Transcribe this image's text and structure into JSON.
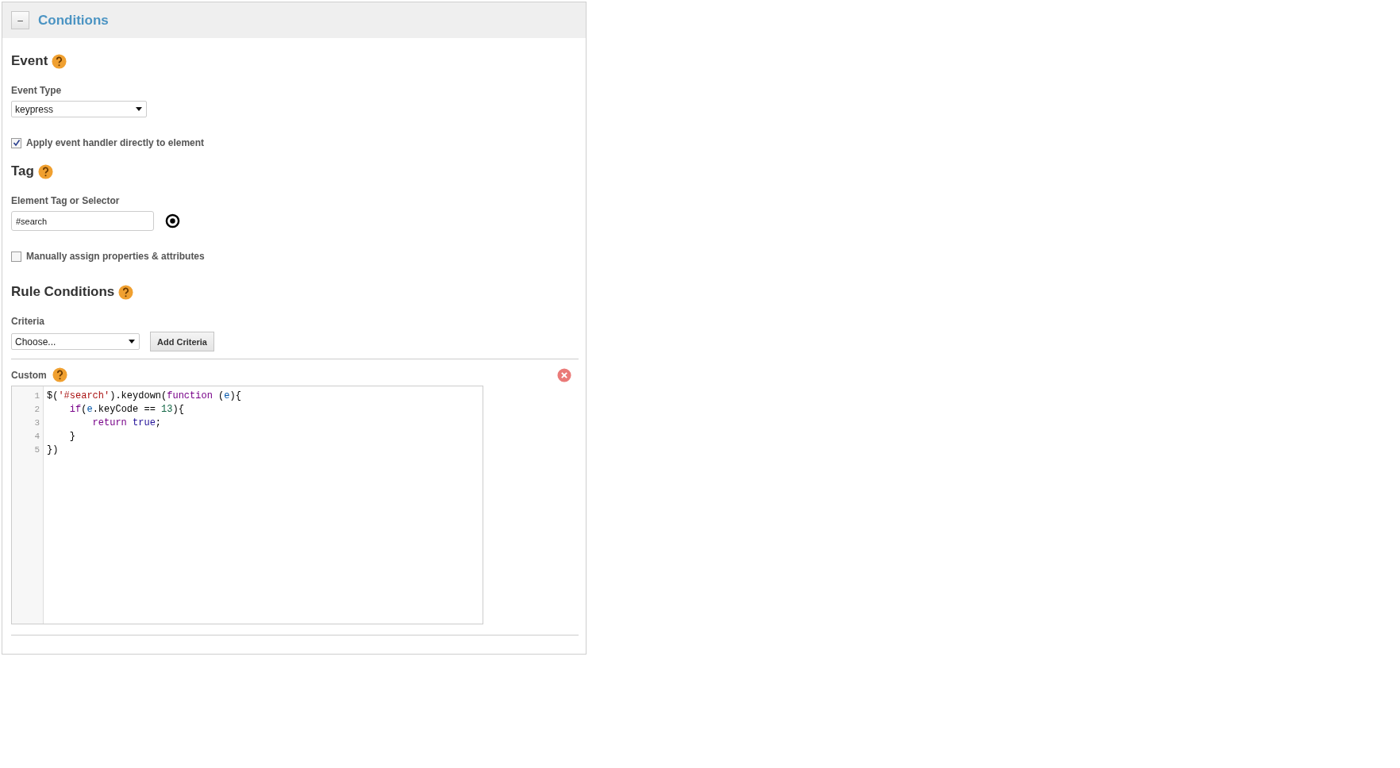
{
  "panel": {
    "title": "Conditions",
    "collapse_button": "–",
    "expanded": true
  },
  "event": {
    "heading": "Event",
    "type_label": "Event Type",
    "type_value": "keypress",
    "apply_label": "Apply event handler directly to element",
    "apply_checked": true
  },
  "tag": {
    "heading": "Tag",
    "selector_label": "Element Tag or Selector",
    "selector_value": "#search",
    "manual_label": "Manually assign properties & attributes",
    "manual_checked": false
  },
  "rule_conditions": {
    "heading": "Rule Conditions",
    "criteria_label": "Criteria",
    "criteria_value": "Choose...",
    "add_button": "Add Criteria"
  },
  "custom": {
    "label": "Custom",
    "code": [
      {
        "number": "1",
        "tokens": [
          {
            "text": "$(",
            "kind": "plain"
          },
          {
            "text": "'#search'",
            "kind": "string"
          },
          {
            "text": ").keydown(",
            "kind": "plain"
          },
          {
            "text": "function",
            "kind": "keyword"
          },
          {
            "text": " (",
            "kind": "plain"
          },
          {
            "text": "e",
            "kind": "variable"
          },
          {
            "text": "){",
            "kind": "plain"
          }
        ]
      },
      {
        "number": "2",
        "tokens": [
          {
            "text": "    if",
            "kind": "keyword"
          },
          {
            "text": "(",
            "kind": "plain"
          },
          {
            "text": "e",
            "kind": "variable"
          },
          {
            "text": ".keyCode == ",
            "kind": "plain"
          },
          {
            "text": "13",
            "kind": "number"
          },
          {
            "text": "){",
            "kind": "plain"
          }
        ]
      },
      {
        "number": "3",
        "tokens": [
          {
            "text": "        return",
            "kind": "keyword"
          },
          {
            "text": " true",
            "kind": "atom"
          },
          {
            "text": ";",
            "kind": "plain"
          }
        ]
      },
      {
        "number": "4",
        "tokens": [
          {
            "text": "    }",
            "kind": "plain"
          }
        ]
      },
      {
        "number": "5",
        "tokens": [
          {
            "text": "})",
            "kind": "plain"
          }
        ]
      }
    ]
  }
}
